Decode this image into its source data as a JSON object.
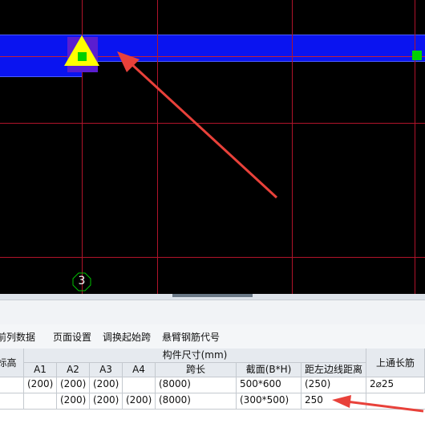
{
  "canvas": {
    "axis_label": "3"
  },
  "toolbar": {
    "buttons": [
      "前列数据",
      "页面设置",
      "调换起始跨",
      "悬臂钢筋代号"
    ]
  },
  "table": {
    "header": {
      "elev": "标高",
      "group": "构件尺寸(mm)",
      "cols": [
        "A1",
        "A2",
        "A3",
        "A4",
        "跨长",
        "截面(B*H)",
        "距左边线距离"
      ],
      "top_rebar": "上通长筋"
    },
    "rows": [
      {
        "a1": "(200)",
        "a2": "(200)",
        "a3": "(200)",
        "a4": "",
        "span": "(8000)",
        "section": "500*600",
        "dist": "(250)",
        "top_rebar": "2⌀25"
      },
      {
        "a1": "",
        "a2": "(200)",
        "a3": "(200)",
        "a4": "(200)",
        "span": "(8000)",
        "section": "(300*500)",
        "dist": "250",
        "top_rebar": ""
      }
    ]
  },
  "colors": {
    "beam": "#0a14f0",
    "axis": "#b0142a",
    "marker": "#ffff00",
    "annotation_arrow": "#e8413a"
  }
}
